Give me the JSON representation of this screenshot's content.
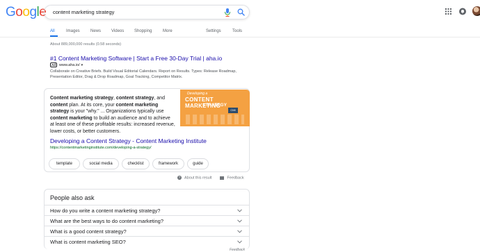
{
  "logo": {
    "letters": [
      {
        "ch": "G",
        "color": "#4285F4"
      },
      {
        "ch": "o",
        "color": "#EA4335"
      },
      {
        "ch": "o",
        "color": "#FBBC05"
      },
      {
        "ch": "g",
        "color": "#4285F4"
      },
      {
        "ch": "l",
        "color": "#34A853"
      },
      {
        "ch": "e",
        "color": "#EA4335"
      }
    ]
  },
  "search": {
    "query": "content marketing strategy",
    "mic_icon": "mic-icon",
    "search_icon": "search-icon"
  },
  "header_icons": [
    "apps-grid-icon",
    "notifications-icon",
    "avatar"
  ],
  "tabs": {
    "items": [
      "All",
      "Images",
      "News",
      "Videos",
      "Shopping",
      "More"
    ],
    "active": "All",
    "settings": "Settings",
    "tools": "Tools"
  },
  "stats": "About 889,000,000 results (0.58 seconds)",
  "ad": {
    "title": "#1 Content Marketing Software | Start a Free 30-Day Trial | aha.io",
    "badge": "Ad",
    "url": "www.aha.io/",
    "description": "Collaborate on Creative Briefs. Build Visual Editorial Calendars. Report on Results. Types: Release Roadmap, Presentation Editor, Drag & Drop Roadmap, Goal Tracking, Competitor Matrix."
  },
  "snippet": {
    "segments": [
      {
        "t": "Content marketing strategy",
        "b": true
      },
      {
        "t": ", ",
        "b": false
      },
      {
        "t": "content strategy",
        "b": true
      },
      {
        "t": ", and ",
        "b": false
      },
      {
        "t": "content",
        "b": true
      },
      {
        "t": " plan. At its core, your ",
        "b": false
      },
      {
        "t": "content marketing strategy",
        "b": true
      },
      {
        "t": " is your \"why.\" ... Organizations typically use ",
        "b": false
      },
      {
        "t": "content marketing",
        "b": true
      },
      {
        "t": " to build an audience and to achieve at least one of these profitable results: increased revenue, lower costs, or better customers.",
        "b": false
      }
    ],
    "image": {
      "line1": "Developing a",
      "line2": "CONTENT MARKETING",
      "line3": "STRATEGY",
      "badge": "CMI"
    },
    "link_title": "Developing a Content Strategy - Content Marketing Institute",
    "link_url": "https://contentmarketinginstitute.com/developing-a-strategy/",
    "chips": [
      "template",
      "social media",
      "checklist",
      "framework",
      "guide"
    ],
    "about": "About this result",
    "feedback": "Feedback"
  },
  "paa": {
    "title": "People also ask",
    "questions": [
      "How do you write a content marketing strategy?",
      "What are the best ways to do content marketing?",
      "What is a good content strategy?",
      "What is content marketing SEO?"
    ],
    "feedback": "Feedback"
  }
}
